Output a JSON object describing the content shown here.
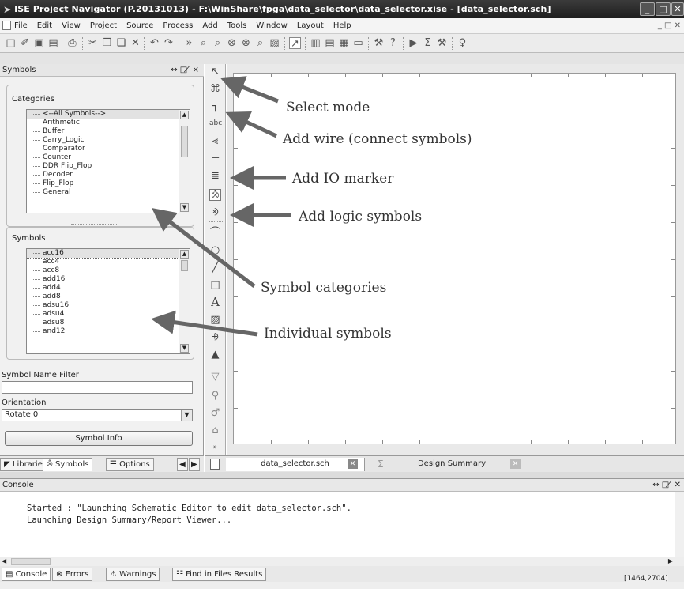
{
  "window": {
    "title": "ISE Project Navigator (P.20131013) - F:\\WinShare\\fpga\\data_selector\\data_selector.xise - [data_selector.sch]"
  },
  "menu": [
    "File",
    "Edit",
    "View",
    "Project",
    "Source",
    "Process",
    "Add",
    "Tools",
    "Window",
    "Layout",
    "Help"
  ],
  "symbols_panel": {
    "title": "Symbols",
    "header_controls": "↔ □ ̸ ×",
    "categories_label": "Categories",
    "categories": [
      "<--All Symbols-->",
      "Arithmetic",
      "Buffer",
      "Carry_Logic",
      "Comparator",
      "Counter",
      "DDR Flip_Flop",
      "Decoder",
      "Flip_Flop",
      "General"
    ],
    "symbols_label": "Symbols",
    "symbols": [
      "acc16",
      "acc4",
      "acc8",
      "add16",
      "add4",
      "add8",
      "adsu16",
      "adsu4",
      "adsu8",
      "and12"
    ],
    "filter_label": "Symbol Name Filter",
    "filter_value": "",
    "orientation_label": "Orientation",
    "orientation_value": "Rotate 0",
    "info_button": "Symbol Info"
  },
  "left_tabs": [
    "Libraries",
    "Symbols",
    "Options"
  ],
  "editor_tabs": [
    "data_selector.sch",
    "Design Summary"
  ],
  "console": {
    "title": "Console",
    "lines": [
      "Started : \"Launching Schematic Editor to edit data_selector.sch\".",
      "Launching Design Summary/Report Viewer..."
    ]
  },
  "console_tabs": [
    "Console",
    "Errors",
    "Warnings",
    "Find in Files Results"
  ],
  "status": {
    "coords": "[1464,2704]"
  },
  "annotations": {
    "select_mode": "Select mode",
    "add_wire": "Add wire (connect symbols)",
    "add_io": "Add IO marker",
    "add_logic": "Add logic symbols",
    "symbol_categories": "Symbol categories",
    "individual_symbols": "Individual symbols"
  }
}
